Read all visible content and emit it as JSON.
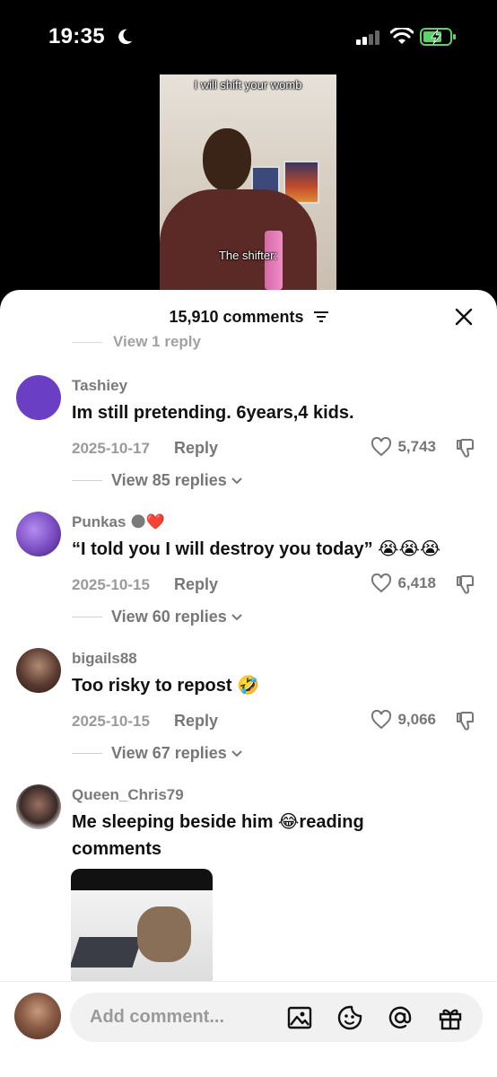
{
  "status_bar": {
    "time": "19:35"
  },
  "video": {
    "caption_top": "I will shift your womb",
    "caption_mid": "The shifter:"
  },
  "sheet": {
    "comments_count": "15,910 comments",
    "faded_reply_link": "View 1 reply"
  },
  "comments": [
    {
      "username": "Tashiey",
      "text": "Im still pretending. 6years,4 kids.",
      "date": "2025-10-17",
      "reply_label": "Reply",
      "likes": "5,743",
      "view_replies": "View 85 replies",
      "avatar_color": "#6a3fc4"
    },
    {
      "username": "Punkas 🌑❤️",
      "text": "“I told you I will destroy you today” 😭😭😭",
      "date": "2025-10-15",
      "reply_label": "Reply",
      "likes": "6,418",
      "view_replies": "View 60 replies",
      "avatar_color": "#7a4cc0"
    },
    {
      "username": "bigails88",
      "text": "Too risky to repost 🤣",
      "date": "2025-10-15",
      "reply_label": "Reply",
      "likes": "9,066",
      "view_replies": "View 67 replies",
      "avatar_color": "#4a3a34"
    },
    {
      "username": "Queen_Chris79",
      "text": "Me sleeping beside him 😂reading comments",
      "avatar_color": "#3a2a28"
    }
  ],
  "input_bar": {
    "placeholder": "Add comment..."
  },
  "icons": [
    "moon-icon",
    "signal-icon",
    "wifi-icon",
    "battery-icon",
    "filter-icon",
    "close-icon",
    "heart-icon",
    "dislike-icon",
    "chevron-down-icon",
    "image-icon",
    "emoji-icon",
    "mention-icon",
    "gift-icon"
  ]
}
